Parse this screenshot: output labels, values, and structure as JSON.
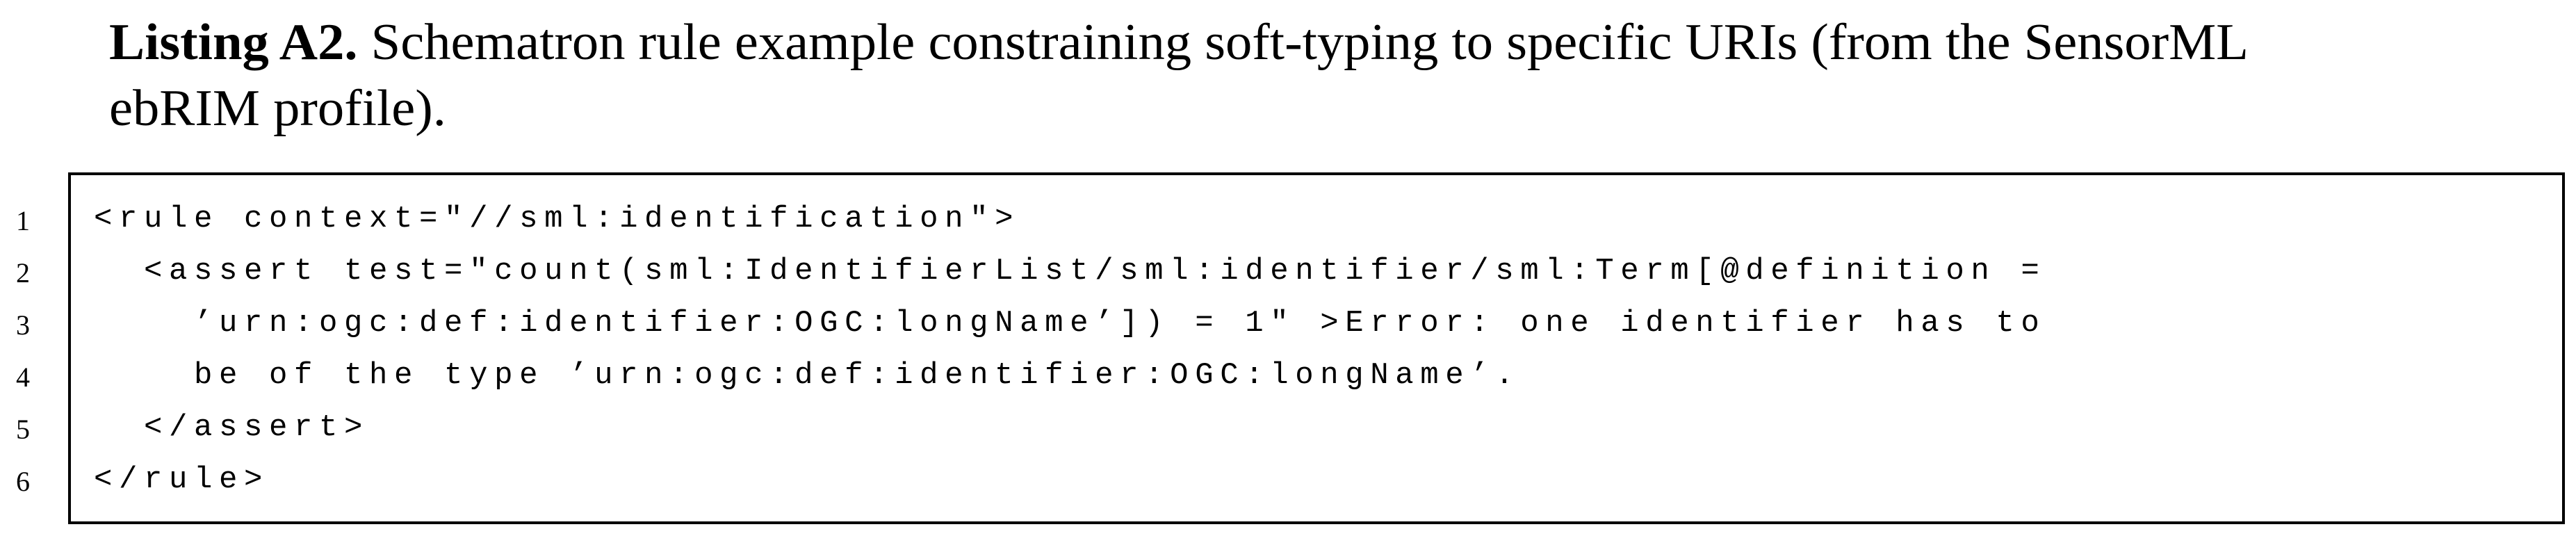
{
  "caption": {
    "label": "Listing A2.",
    "text_line1": " Schematron rule example constraining soft-typing to specific URIs (from the SensorML",
    "text_line2": "ebRIM profile)."
  },
  "listing": {
    "lines": [
      {
        "number": "1",
        "code": "<rule context=\"//sml:identification\">"
      },
      {
        "number": "2",
        "code": "  <assert test=\"count(sml:IdentifierList/sml:identifier/sml:Term[@definition ="
      },
      {
        "number": "3",
        "code": "    ’urn:ogc:def:identifier:OGC:longName’]) = 1\" >Error: one identifier has to"
      },
      {
        "number": "4",
        "code": "    be of the type ’urn:ogc:def:identifier:OGC:longName’."
      },
      {
        "number": "5",
        "code": "  </assert>"
      },
      {
        "number": "6",
        "code": "</rule>"
      }
    ]
  }
}
